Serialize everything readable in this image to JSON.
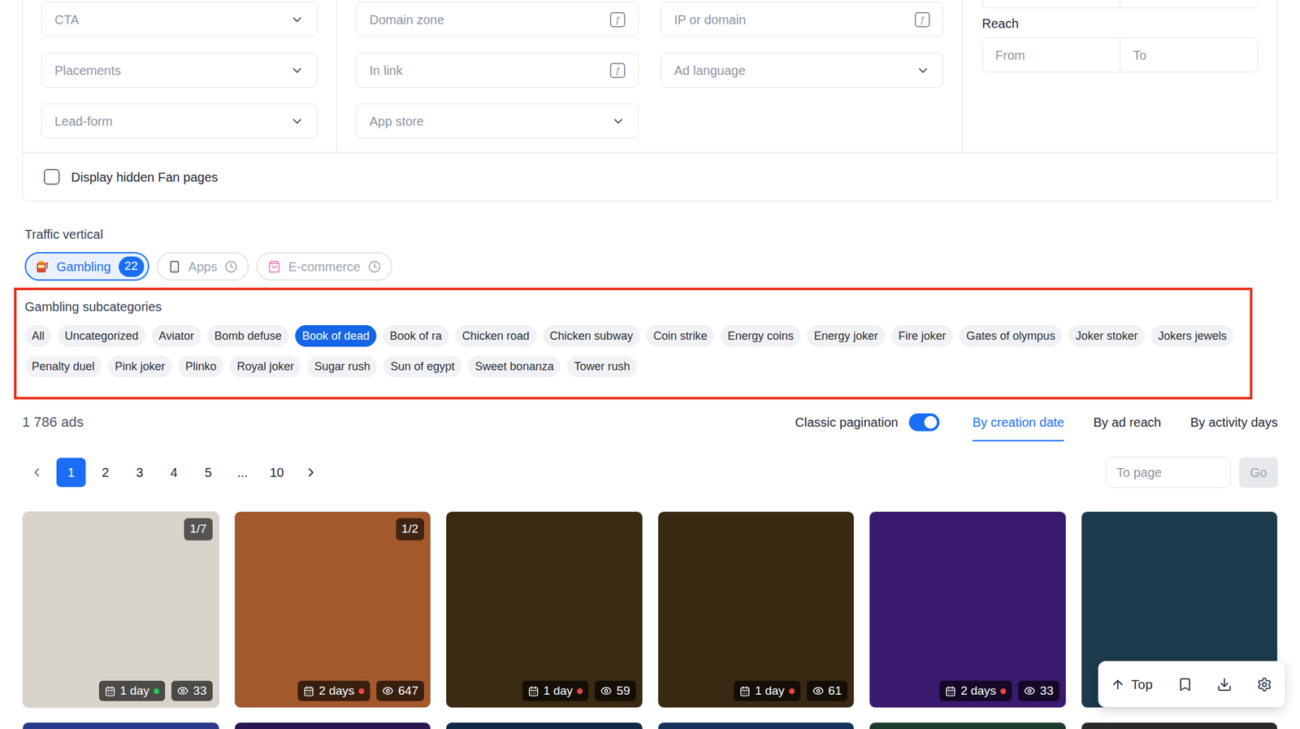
{
  "filter_panel": {
    "field_groups": [
      {
        "fields": [
          {
            "placeholder": "CTA",
            "kind": "select"
          },
          {
            "placeholder": "Placements",
            "kind": "select"
          },
          {
            "placeholder": "Lead-form",
            "kind": "select"
          }
        ]
      },
      {
        "fields": [
          {
            "placeholder": "Domain zone",
            "kind": "formula",
            "icon": "ƒ"
          },
          {
            "placeholder": "IP or domain",
            "kind": "formula",
            "icon": "ƒ"
          },
          {
            "placeholder": "In link",
            "kind": "formula",
            "icon": "ƒ"
          },
          {
            "placeholder": "Ad language",
            "kind": "select"
          },
          {
            "placeholder": "App store",
            "kind": "select"
          }
        ]
      }
    ],
    "reach": {
      "label": "Reach",
      "from": "From",
      "to": "To"
    },
    "hidden_fan_pages": {
      "label": "Display hidden Fan pages",
      "checked": false
    }
  },
  "traffic_vertical": {
    "label": "Traffic vertical",
    "items": [
      {
        "label": "Gambling",
        "count": "22",
        "selected": true,
        "disabled": false
      },
      {
        "label": "Apps",
        "selected": false,
        "disabled": true
      },
      {
        "label": "E-commerce",
        "selected": false,
        "disabled": true
      }
    ]
  },
  "subcategories": {
    "label": "Gambling subcategories",
    "items": [
      {
        "label": "All",
        "selected": false
      },
      {
        "label": "Uncategorized",
        "selected": false
      },
      {
        "label": "Aviator",
        "selected": false
      },
      {
        "label": "Bomb defuse",
        "selected": false
      },
      {
        "label": "Book of dead",
        "selected": true
      },
      {
        "label": "Book of ra",
        "selected": false
      },
      {
        "label": "Chicken road",
        "selected": false
      },
      {
        "label": "Chicken subway",
        "selected": false
      },
      {
        "label": "Coin strike",
        "selected": false
      },
      {
        "label": "Energy coins",
        "selected": false
      },
      {
        "label": "Energy joker",
        "selected": false
      },
      {
        "label": "Fire joker",
        "selected": false
      },
      {
        "label": "Gates of olympus",
        "selected": false
      },
      {
        "label": "Joker stoker",
        "selected": false
      },
      {
        "label": "Jokers jewels",
        "selected": false
      },
      {
        "label": "Penalty duel",
        "selected": false
      },
      {
        "label": "Pink joker",
        "selected": false
      },
      {
        "label": "Plinko",
        "selected": false
      },
      {
        "label": "Royal joker",
        "selected": false
      },
      {
        "label": "Sugar rush",
        "selected": false
      },
      {
        "label": "Sun of egypt",
        "selected": false
      },
      {
        "label": "Sweet bonanza",
        "selected": false
      },
      {
        "label": "Tower rush",
        "selected": false
      }
    ]
  },
  "results": {
    "count": "1 786 ads",
    "classic_pagination": {
      "label": "Classic pagination",
      "on": true
    },
    "sorts": [
      {
        "label": "By creation date",
        "selected": true
      },
      {
        "label": "By ad reach",
        "selected": false
      },
      {
        "label": "By activity days",
        "selected": false
      }
    ]
  },
  "pagination": {
    "pages": [
      {
        "label": "1",
        "selected": true
      },
      {
        "label": "2",
        "selected": false
      },
      {
        "label": "3",
        "selected": false
      },
      {
        "label": "4",
        "selected": false
      },
      {
        "label": "5",
        "selected": false
      },
      {
        "label": "...",
        "selected": false
      },
      {
        "label": "10",
        "selected": false
      }
    ],
    "to_page": {
      "placeholder": "To page"
    },
    "go": {
      "label": "Go",
      "disabled": true
    }
  },
  "cards": [
    {
      "counter": "1/7",
      "days": "1 day",
      "status_color": "#22c55e",
      "views": "33"
    },
    {
      "counter": "1/2",
      "days": "2 days",
      "status_color": "#ef4444",
      "views": "647"
    },
    {
      "counter": "",
      "days": "1 day",
      "status_color": "#ef4444",
      "views": "59"
    },
    {
      "counter": "",
      "days": "1 day",
      "status_color": "#ef4444",
      "views": "61"
    },
    {
      "counter": "",
      "days": "2 days",
      "status_color": "#ef4444",
      "views": "33"
    },
    {
      "counter": ""
    }
  ],
  "toolbar": {
    "top": "Top"
  }
}
